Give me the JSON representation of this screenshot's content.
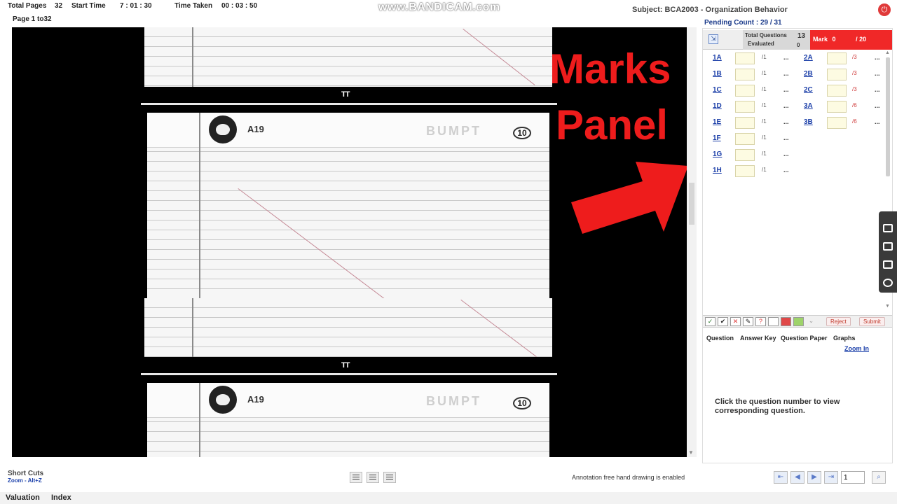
{
  "topbar": {
    "total_pages_label": "Total Pages",
    "total_pages": "32",
    "start_time_label": "Start Time",
    "start_time": "7 : 01 : 30",
    "time_taken_label": "Time Taken",
    "time_taken": "00 : 03 : 50",
    "page_range": "Page 1 to32",
    "watermark": "www.BANDICAM.com",
    "subject": "Subject: BCA2003 - Organization Behavior"
  },
  "sheets": {
    "code": "A19",
    "stamp": "BUMPT",
    "number": "10",
    "divider_mark": "TT"
  },
  "overlay": {
    "line1": "Marks",
    "line2": "Panel"
  },
  "panel": {
    "pending_label": "Pending Count :",
    "pending_value": "29 / 31",
    "total_questions_label": "Total Questions",
    "total_questions": "13",
    "evaluated_label": "Evaluated",
    "evaluated": "0",
    "mark_label": "Mark",
    "mark_value": "0",
    "mark_total": "/ 20",
    "left_questions": [
      {
        "label": "1A",
        "max": "/1"
      },
      {
        "label": "1B",
        "max": "/1"
      },
      {
        "label": "1C",
        "max": "/1"
      },
      {
        "label": "1D",
        "max": "/1"
      },
      {
        "label": "1E",
        "max": "/1"
      },
      {
        "label": "1F",
        "max": "/1"
      },
      {
        "label": "1G",
        "max": "/1"
      },
      {
        "label": "1H",
        "max": "/1"
      }
    ],
    "right_questions": [
      {
        "label": "2A",
        "max": "/3"
      },
      {
        "label": "2B",
        "max": "/3"
      },
      {
        "label": "2C",
        "max": "/3"
      },
      {
        "label": "3A",
        "max": "/6"
      },
      {
        "label": "3B",
        "max": "/6"
      }
    ],
    "dots": "...",
    "reject_label": "Reject",
    "submit_label": "Submit",
    "tabs": [
      "Question",
      "Answer Key",
      "Question Paper",
      "Graphs"
    ],
    "zoom_in": "Zoom In",
    "hint": "Click the question number to view corresponding question."
  },
  "bottom": {
    "shortcuts_label": "Short Cuts",
    "zoom_shortcut": "Zoom - Alt+Z",
    "annotation_status": "Annotation free hand drawing is enabled",
    "page_input": "1",
    "tabs": [
      "Valuation",
      "Index"
    ]
  },
  "colors": {
    "accent_red": "#f02828",
    "link_blue": "#1c3fa8",
    "overlay_red": "#ee1c1c"
  }
}
